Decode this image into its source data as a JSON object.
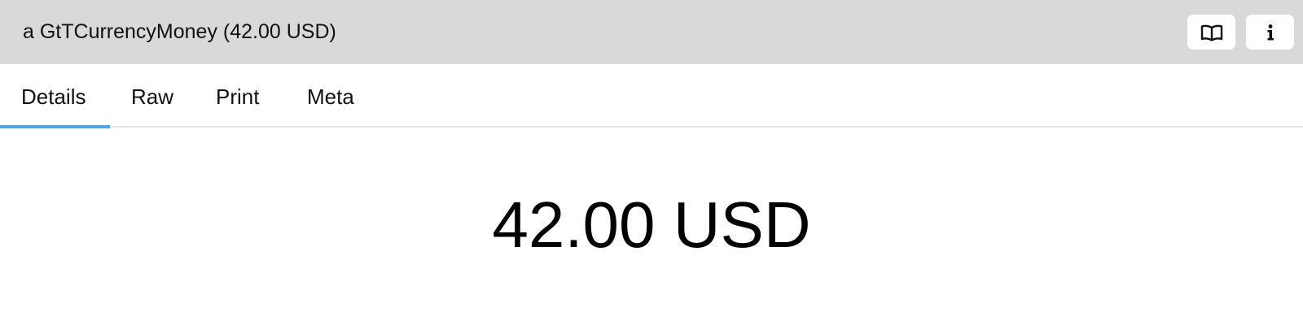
{
  "window": {
    "title": "a GtTCurrencyMoney (42.00 USD)"
  },
  "toolbar": {
    "buttons": [
      {
        "icon": "book-icon"
      },
      {
        "icon": "info-icon"
      }
    ]
  },
  "tabs": [
    {
      "label": "Details",
      "selected": true
    },
    {
      "label": "Raw",
      "selected": false
    },
    {
      "label": "Print",
      "selected": false
    },
    {
      "label": "Meta",
      "selected": false
    }
  ],
  "main": {
    "value": "42.00 USD"
  },
  "colors": {
    "titlebar_bg": "#d9d9d9",
    "tab_indicator": "#4aa3e6"
  }
}
